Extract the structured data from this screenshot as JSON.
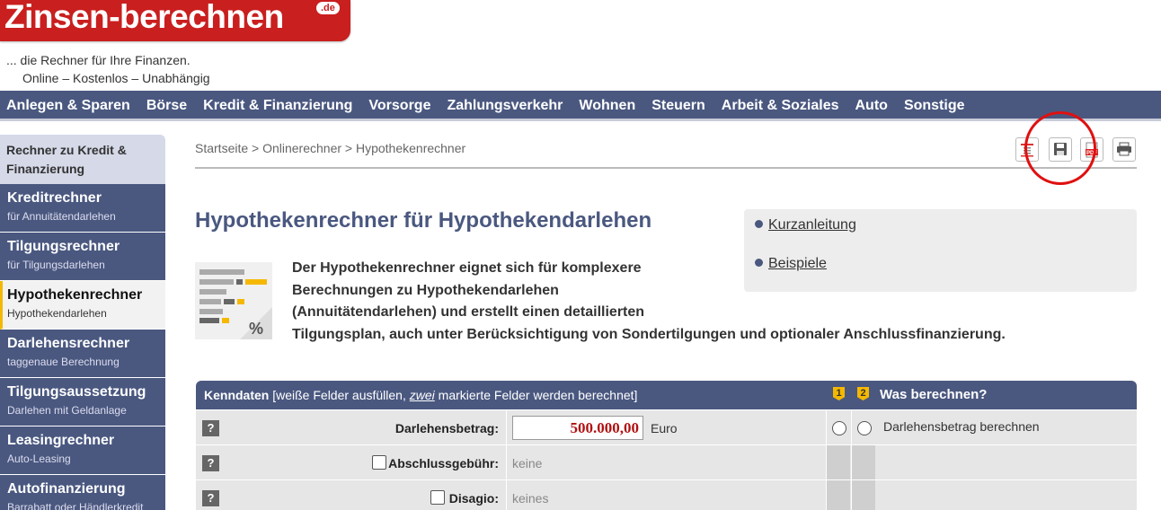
{
  "header": {
    "logo_text": "Zinsen-berechnen",
    "logo_tld": ".de",
    "tagline_1": "... die Rechner für Ihre Finanzen.",
    "tagline_2": "Online – Kostenlos – Unabhängig"
  },
  "topnav": [
    "Anlegen & Sparen",
    "Börse",
    "Kredit & Finanzierung",
    "Vorsorge",
    "Zahlungsverkehr",
    "Wohnen",
    "Steuern",
    "Arbeit & Soziales",
    "Auto",
    "Sonstige"
  ],
  "sidebar": {
    "heading": "Rechner zu Kredit & Finanzierung",
    "items": [
      {
        "title": "Kreditrechner",
        "sub": "für Annuitätendarlehen"
      },
      {
        "title": "Tilgungsrechner",
        "sub": "für Tilgungsdarlehen"
      },
      {
        "title": "Hypothekenrechner",
        "sub": "Hypothekendarlehen"
      },
      {
        "title": "Darlehensrechner",
        "sub": "taggenaue Berechnung"
      },
      {
        "title": "Tilgungsaussetzung",
        "sub": "Darlehen mit Geldanlage"
      },
      {
        "title": "Leasingrechner",
        "sub": "Auto-Leasing"
      },
      {
        "title": "Autofinanzierung",
        "sub": "Barrabatt oder Händlerkredit"
      }
    ]
  },
  "breadcrumb": "Startseite > Onlinerechner > Hypothekenrechner",
  "toolbar": {
    "icons": [
      "list-icon",
      "save-icon",
      "pdf-icon",
      "print-icon"
    ],
    "pdf_label": "PDF"
  },
  "page": {
    "title": "Hypothekenrechner für Hypothekendarlehen",
    "quick_links": [
      "Kurzanleitung",
      "Beispiele"
    ],
    "description_lines": [
      "Der Hypothekenrechner eignet sich für komplexere",
      "Berechnungen zu Hypothekendarlehen",
      "(Annuitätendarlehen) und erstellt einen detaillierten",
      "Tilgungsplan, auch unter Berücksichtigung von Sondertilgungen und optionaler Anschlussfinanzierung."
    ],
    "illustration_symbol": "%"
  },
  "form": {
    "header_title": "Kenndaten",
    "header_note_1": " [weiße Felder ausfüllen, ",
    "header_note_em": "zwei",
    "header_note_2": " markierte Felder werden berechnet]",
    "badge_1": "1",
    "badge_2": "2",
    "calc_header": "Was berechnen?",
    "help_label": "?",
    "rows": [
      {
        "label": "Darlehensbetrag:",
        "value": "500.000,00",
        "unit": "Euro",
        "calc_option": "Darlehensbetrag berechnen"
      },
      {
        "label": "Abschlussgebühr:",
        "value": "keine"
      },
      {
        "label": "Disagio:",
        "value": "keines"
      }
    ]
  },
  "colors": {
    "brand_red": "#c91f1f",
    "nav_blue": "#4a5880",
    "accent_yellow": "#f5b800",
    "annotation_red": "#e01010"
  }
}
